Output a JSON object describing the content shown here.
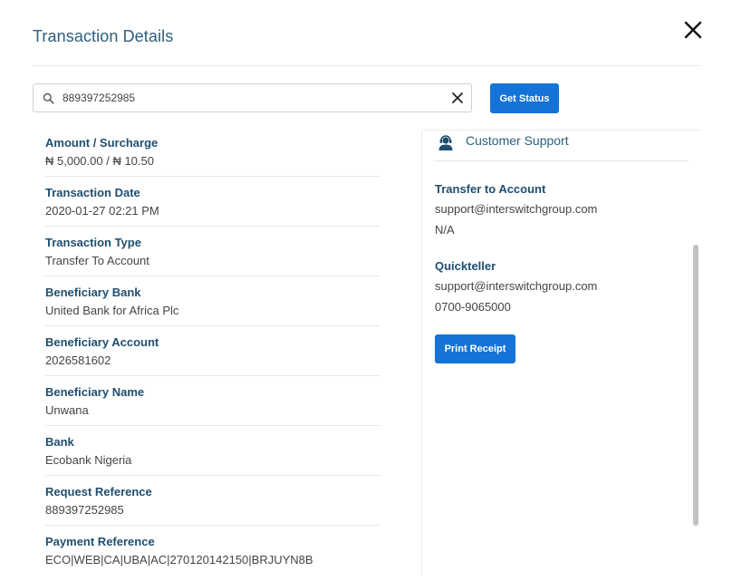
{
  "modal": {
    "title": "Transaction Details",
    "close_icon": "close-icon"
  },
  "search": {
    "value": "889397252985",
    "search_icon": "search-icon",
    "clear_icon": "clear-icon"
  },
  "buttons": {
    "get_status": "Get Status",
    "print_receipt": "Print Receipt"
  },
  "details": [
    {
      "label": "Amount / Surcharge",
      "value": "₦ 5,000.00 / ₦ 10.50"
    },
    {
      "label": "Transaction Date",
      "value": "2020-01-27 02:21 PM"
    },
    {
      "label": "Transaction Type",
      "value": "Transfer To Account"
    },
    {
      "label": "Beneficiary Bank",
      "value": "United Bank for Africa Plc"
    },
    {
      "label": "Beneficiary Account",
      "value": "2026581602"
    },
    {
      "label": "Beneficiary Name",
      "value": "Unwana"
    },
    {
      "label": "Bank",
      "value": "Ecobank Nigeria"
    },
    {
      "label": "Request Reference",
      "value": "889397252985"
    },
    {
      "label": "Payment Reference",
      "value": "ECO|WEB|CA|UBA|AC|270120142150|BRJUYN8B"
    }
  ],
  "support": {
    "title": "Customer Support",
    "icon": "support-agent-icon",
    "transfer": {
      "label": "Transfer to Account",
      "email": "support@interswitchgroup.com",
      "phone": "N/A"
    },
    "quickteller": {
      "label": "Quickteller",
      "email": "support@interswitchgroup.com",
      "phone": "0700-9065000"
    }
  },
  "colors": {
    "accent": "#1473d6",
    "heading": "#1f4e6f",
    "title": "#2d5f7c"
  }
}
